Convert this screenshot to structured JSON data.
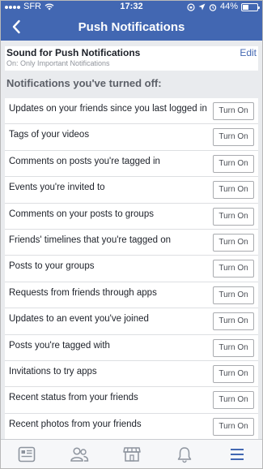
{
  "statusbar": {
    "carrier": "SFR",
    "time": "17:32",
    "battery_text": "44%",
    "battery_level": 0.44
  },
  "navbar": {
    "title": "Push Notifications",
    "back_icon": "chevron-left-icon"
  },
  "sound": {
    "label": "Sound for Push Notifications",
    "value": "On: Only Important Notifications",
    "edit_label": "Edit"
  },
  "section": {
    "title": "Notifications you've turned off:"
  },
  "notifications": [
    {
      "label": "Updates on your friends since you last logged in",
      "button": "Turn On"
    },
    {
      "label": "Tags of your videos",
      "button": "Turn On"
    },
    {
      "label": "Comments on posts you're tagged in",
      "button": "Turn On"
    },
    {
      "label": "Events you're invited to",
      "button": "Turn On"
    },
    {
      "label": "Comments on your posts to groups",
      "button": "Turn On"
    },
    {
      "label": "Friends' timelines that you're tagged on",
      "button": "Turn On"
    },
    {
      "label": "Posts to your groups",
      "button": "Turn On"
    },
    {
      "label": "Requests from friends through apps",
      "button": "Turn On"
    },
    {
      "label": "Updates to an event you've joined",
      "button": "Turn On"
    },
    {
      "label": "Posts you're tagged with",
      "button": "Turn On"
    },
    {
      "label": "Invitations to try apps",
      "button": "Turn On"
    },
    {
      "label": "Recent status from your friends",
      "button": "Turn On"
    },
    {
      "label": "Recent photos from your friends",
      "button": "Turn On"
    }
  ],
  "tabbar": {
    "tabs": [
      {
        "name": "news-feed-icon"
      },
      {
        "name": "friends-icon"
      },
      {
        "name": "marketplace-icon"
      },
      {
        "name": "notifications-bell-icon"
      },
      {
        "name": "menu-icon",
        "active": true
      }
    ],
    "active_color": "#4267b2",
    "inactive_color": "#8d949e"
  },
  "colors": {
    "brand": "#4267b2",
    "background": "#e9ebee"
  }
}
